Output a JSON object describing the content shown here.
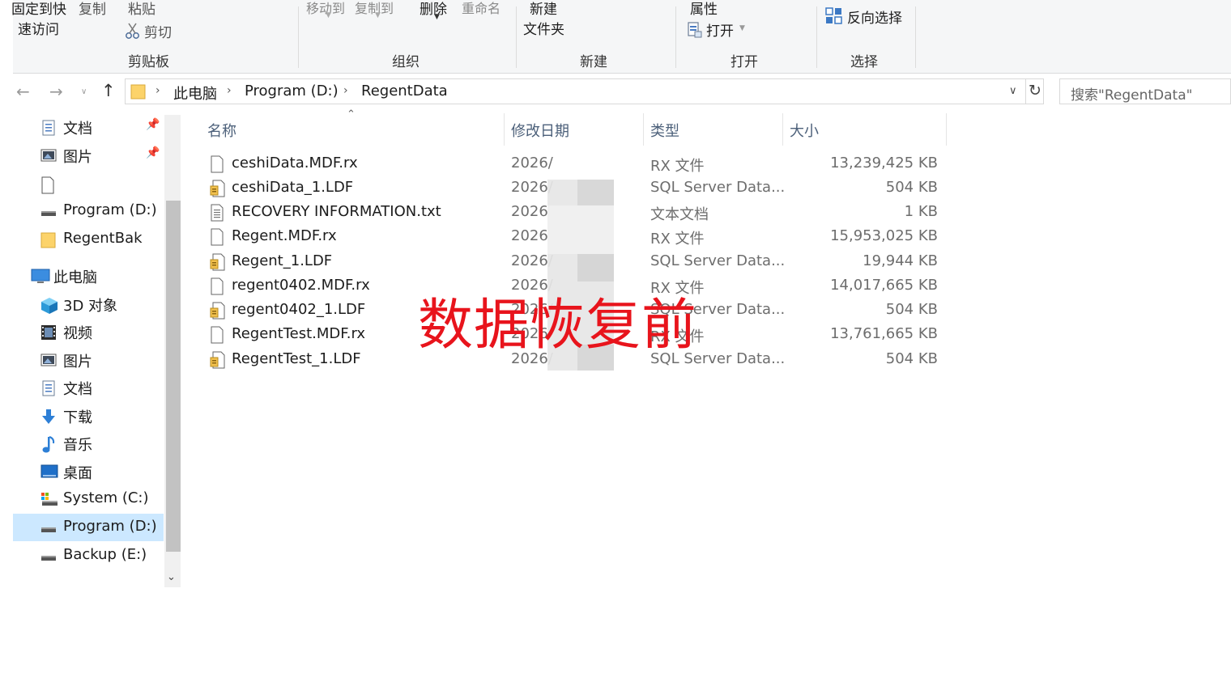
{
  "ribbon": {
    "pin_quick_access_line1": "固定到快",
    "pin_quick_access_line2": "速访问",
    "copy": "复制",
    "paste": "粘贴",
    "cut": "剪切",
    "move_to": "移动到",
    "copy_to": "复制到",
    "delete": "删除",
    "rename": "重命名",
    "new_folder_line1": "新建",
    "new_folder_line2": "文件夹",
    "properties": "属性",
    "open": "打开",
    "invert_selection": "反向选择",
    "groups": {
      "clipboard": "剪贴板",
      "organize": "组织",
      "new": "新建",
      "open": "打开",
      "select": "选择"
    }
  },
  "address": {
    "crumbs": [
      "此电脑",
      "Program (D:)",
      "RegentData"
    ]
  },
  "search": {
    "placeholder": "搜索\"RegentData\""
  },
  "sidebar": {
    "items": [
      {
        "label": "文档",
        "pinned": true
      },
      {
        "label": "图片",
        "pinned": true
      },
      {
        "label": ""
      },
      {
        "label": "Program (D:)"
      },
      {
        "label": "RegentBak"
      },
      {
        "label": "此电脑"
      },
      {
        "label": "3D 对象"
      },
      {
        "label": "视频"
      },
      {
        "label": "图片"
      },
      {
        "label": "文档"
      },
      {
        "label": "下载"
      },
      {
        "label": "音乐"
      },
      {
        "label": "桌面"
      },
      {
        "label": "System (C:)"
      },
      {
        "label": "Program (D:)",
        "selected": true
      },
      {
        "label": "Backup (E:)"
      }
    ]
  },
  "file_list": {
    "columns": [
      "名称",
      "修改日期",
      "类型",
      "大小"
    ],
    "rows": [
      {
        "name": "ceshiData.MDF.rx",
        "date": "2026/",
        "type": "RX 文件",
        "size": "13,239,425 KB",
        "icon": "file"
      },
      {
        "name": "ceshiData_1.LDF",
        "date": "2026/",
        "type": "SQL Server Data...",
        "size": "504 KB",
        "icon": "sql"
      },
      {
        "name": "RECOVERY INFORMATION.txt",
        "date": "2026/",
        "type": "文本文档",
        "size": "1 KB",
        "icon": "txt"
      },
      {
        "name": "Regent.MDF.rx",
        "date": "2026/",
        "type": "RX 文件",
        "size": "15,953,025 KB",
        "icon": "file"
      },
      {
        "name": "Regent_1.LDF",
        "date": "2026/",
        "type": "SQL Server Data...",
        "size": "19,944 KB",
        "icon": "sql"
      },
      {
        "name": "regent0402.MDF.rx",
        "date": "2026/",
        "type": "RX 文件",
        "size": "14,017,665 KB",
        "icon": "file"
      },
      {
        "name": "regent0402_1.LDF",
        "date": "2026/",
        "type": "SQL Server Data...",
        "size": "504 KB",
        "icon": "sql"
      },
      {
        "name": "RegentTest.MDF.rx",
        "date": "2026/",
        "type": "RX 文件",
        "size": "13,761,665 KB",
        "icon": "file"
      },
      {
        "name": "RegentTest_1.LDF",
        "date": "2026/",
        "type": "SQL Server Data...",
        "size": "504 KB",
        "icon": "sql"
      }
    ]
  },
  "overlay": {
    "watermark": "数据恢复前"
  },
  "colors": {
    "watermark": "#e8141c",
    "selected_bg": "#cce8ff",
    "header_text": "#4c607a"
  }
}
